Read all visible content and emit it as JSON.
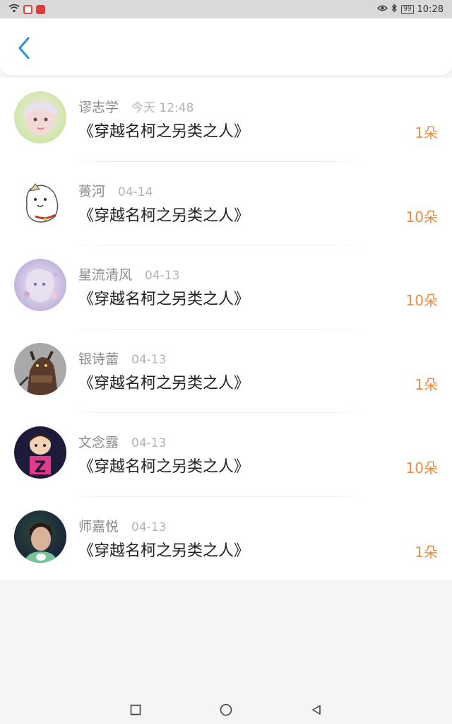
{
  "status_bar": {
    "time": "10:28",
    "battery": "99"
  },
  "header": {
    "back_icon": "chevron-left-icon"
  },
  "gifts": [
    {
      "name": "谬志学",
      "time": "今天 12:48",
      "title": "《穿越名柯之另类之人》",
      "amount": "1朵"
    },
    {
      "name": "蒉河",
      "time": "04-14",
      "title": "《穿越名柯之另类之人》",
      "amount": "10朵"
    },
    {
      "name": "星流清风",
      "time": "04-13",
      "title": "《穿越名柯之另类之人》",
      "amount": "10朵"
    },
    {
      "name": "银诗蕾",
      "time": "04-13",
      "title": "《穿越名柯之另类之人》",
      "amount": "1朵"
    },
    {
      "name": "文念露",
      "time": "04-13",
      "title": "《穿越名柯之另类之人》",
      "amount": "10朵"
    },
    {
      "name": "师嘉悦",
      "time": "04-13",
      "title": "《穿越名柯之另类之人》",
      "amount": "1朵"
    }
  ],
  "colors": {
    "accent_blue": "#2d8fe0",
    "flower_orange": "#f08a3c"
  }
}
